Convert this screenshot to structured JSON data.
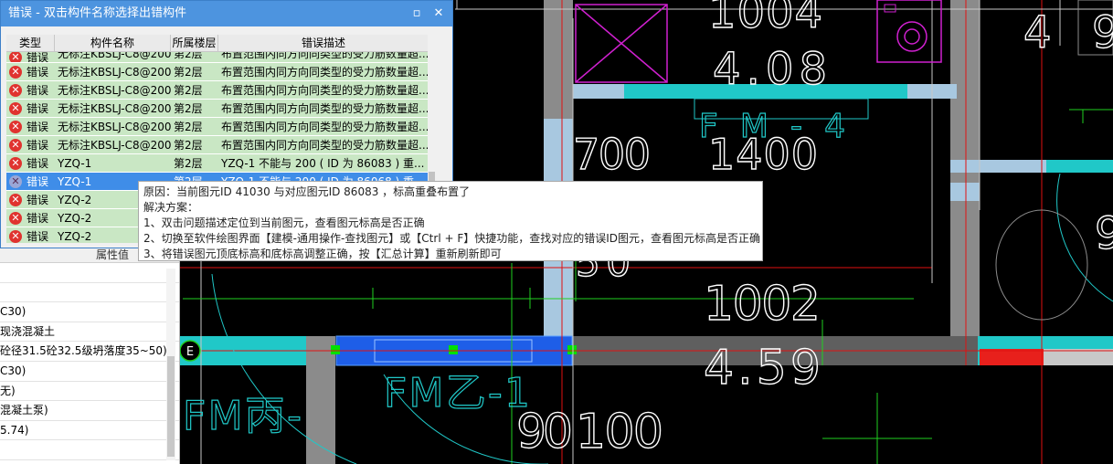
{
  "dialog": {
    "title": "错误 - 双击构件名称选择出错构件",
    "columns": [
      "类型",
      "构件名称",
      "所属楼层",
      "错误描述"
    ],
    "partial_row": {
      "type": "错误",
      "name": "无标注KBSLJ-C8@200",
      "floor": "第2层",
      "desc": "布置范围内同方向同类型的受力筋数量超..."
    },
    "rows": [
      {
        "type": "错误",
        "name": "无标注KBSLJ-C8@200",
        "floor": "第2层",
        "desc": "布置范围内同方向同类型的受力筋数量超..."
      },
      {
        "type": "错误",
        "name": "无标注KBSLJ-C8@200",
        "floor": "第2层",
        "desc": "布置范围内同方向同类型的受力筋数量超..."
      },
      {
        "type": "错误",
        "name": "无标注KBSLJ-C8@200",
        "floor": "第2层",
        "desc": "布置范围内同方向同类型的受力筋数量超..."
      },
      {
        "type": "错误",
        "name": "无标注KBSLJ-C8@200",
        "floor": "第2层",
        "desc": "布置范围内同方向同类型的受力筋数量超..."
      },
      {
        "type": "错误",
        "name": "无标注KBSLJ-C8@200",
        "floor": "第2层",
        "desc": "布置范围内同方向同类型的受力筋数量超..."
      },
      {
        "type": "错误",
        "name": "YZQ-1",
        "floor": "第2层",
        "desc": "YZQ-1 不能与 200 ( ID 为 86083 ) 重..."
      },
      {
        "type": "错误",
        "name": "YZQ-1",
        "floor": "第2层",
        "desc": "YZQ-1 不能与 200 ( ID 为 86068 ) 重..."
      },
      {
        "type": "错误",
        "name": "YZQ-2",
        "floor": "",
        "desc": ""
      },
      {
        "type": "错误",
        "name": "YZQ-2",
        "floor": "",
        "desc": ""
      },
      {
        "type": "错误",
        "name": "YZQ-2",
        "floor": "",
        "desc": ""
      }
    ],
    "selected_index": 6
  },
  "tooltip": {
    "cause": "原因：当前图元ID 41030 与对应图元ID 86083 ，标高重叠布置了",
    "solution_title": "解决方案：",
    "steps": [
      "1、双击问题描述定位到当前图元，查看图元标高是否正确",
      "2、切换至软件绘图界面【建模-通用操作-查找图元】或【Ctrl + F】快捷功能，查找对应的错误ID图元，查看图元标高是否正确",
      "3、将错误图元顶底标高和底标高调整正确，按【汇总计算】重新刷新即可"
    ]
  },
  "property_panel": {
    "header": "属性值",
    "rows": [
      "",
      "",
      "C30)",
      "现浇混凝土",
      "砼径31.5砼32.5级坍落度35~50)",
      "C30)",
      "无)",
      "混凝土泵)",
      "5.74)",
      ""
    ]
  },
  "canvas_labels": {
    "t1004": "1004",
    "t408": "4.08",
    "t4": "4",
    "t9": "9",
    "t700": "700",
    "t1400": "1400",
    "t1002": "1002",
    "t459": "4.59",
    "t90": "90",
    "t100": "100",
    "t50": "50",
    "fm4": "FM-4",
    "fmb": "FM丙-",
    "fmy": "FM乙-1",
    "axis_e": "E"
  }
}
